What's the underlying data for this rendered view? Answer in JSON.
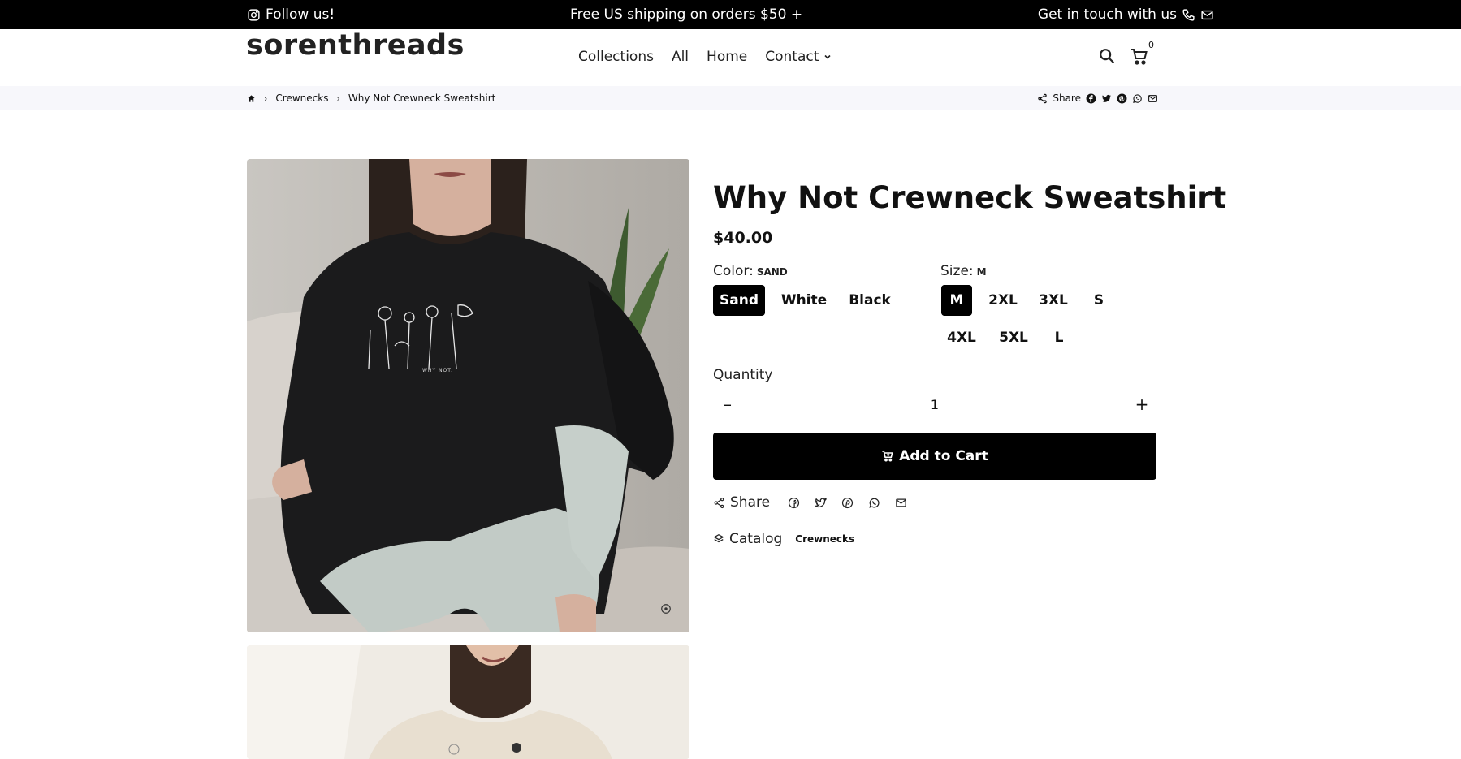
{
  "announcement": {
    "follow_text": "Follow us!",
    "shipping_text": "Free US shipping on orders $50 +",
    "contact_text": "Get in touch with us"
  },
  "header": {
    "logo": "sorenthreads",
    "nav": [
      "Collections",
      "All",
      "Home",
      "Contact"
    ],
    "cart_count": "0"
  },
  "breadcrumb": {
    "items": [
      "Crewnecks",
      "Why Not Crewneck Sweatshirt"
    ],
    "share_label": "Share"
  },
  "product": {
    "title": "Why Not Crewneck Sweatshirt",
    "price": "$40.00",
    "color_label": "Color:",
    "color_selected": "SAND",
    "colors": [
      "Sand",
      "White",
      "Black"
    ],
    "size_label": "Size:",
    "size_selected": "M",
    "sizes": [
      "M",
      "2XL",
      "3XL",
      "S",
      "4XL",
      "5XL",
      "L"
    ],
    "quantity_label": "Quantity",
    "quantity_value": "1",
    "quantity_minus": "–",
    "quantity_plus": "+",
    "add_to_cart": "Add to Cart",
    "share_label": "Share",
    "catalog_label": "Catalog",
    "catalog_tag": "Crewnecks"
  }
}
